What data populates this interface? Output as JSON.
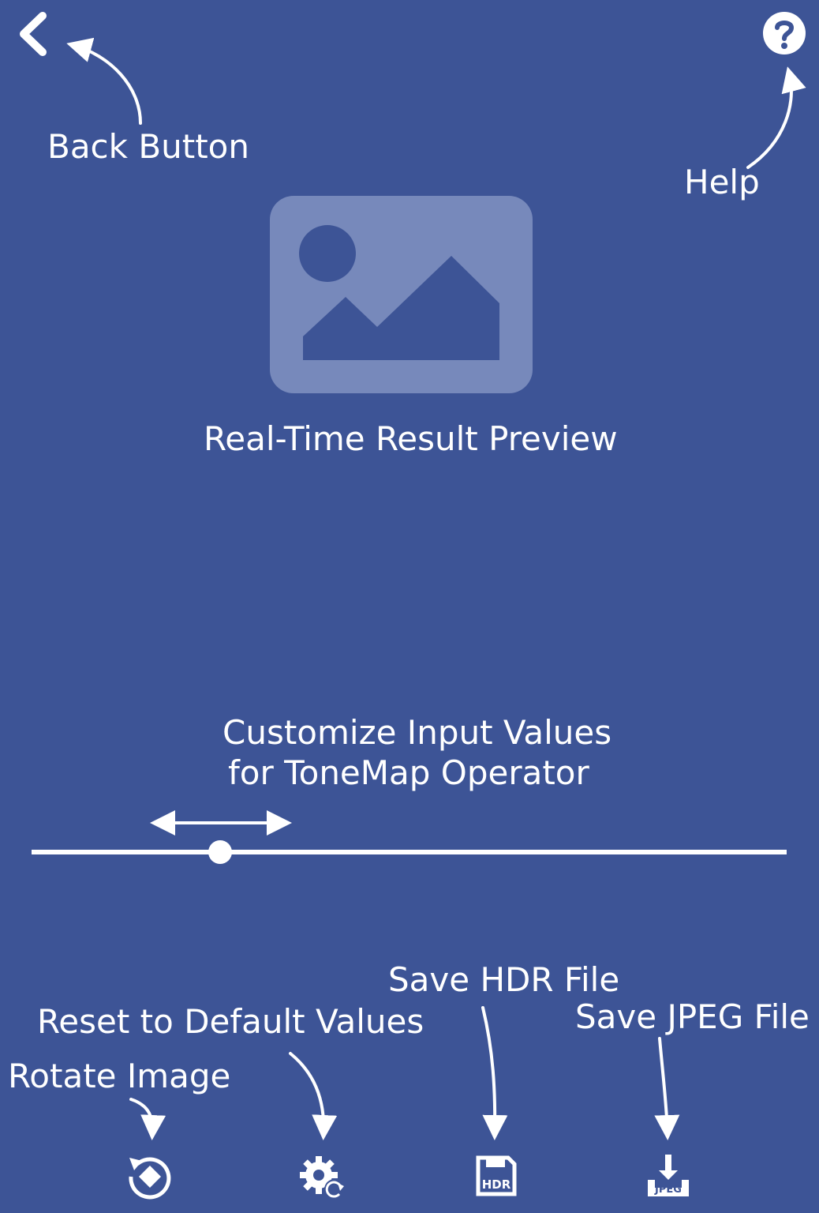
{
  "theme": {
    "background": "#3d5496",
    "foreground": "#ffffff",
    "placeholder": "#7789bb"
  },
  "toolbar": {
    "back_icon": "chevron-left-icon",
    "help_icon": "question-circle-icon"
  },
  "annotations": {
    "back": "Back Button",
    "help": "Help",
    "preview": "Real-Time Result Preview",
    "customize_line1": "Customize Input Values",
    "customize_line2": "for ToneMap Operator",
    "save_hdr": "Save HDR File",
    "reset": "Reset to Default Values",
    "save_jpeg": "Save JPEG File",
    "rotate": "Rotate Image"
  },
  "preview": {
    "icon": "image-placeholder-icon"
  },
  "slider": {
    "value": 0.25
  },
  "bottom_bar": {
    "rotate_icon": "rotate-icon",
    "reset_icon": "gear-reset-icon",
    "hdr_icon": "save-hdr-icon",
    "hdr_text": "HDR",
    "jpeg_icon": "save-jpeg-icon",
    "jpeg_text": "JPEG"
  }
}
